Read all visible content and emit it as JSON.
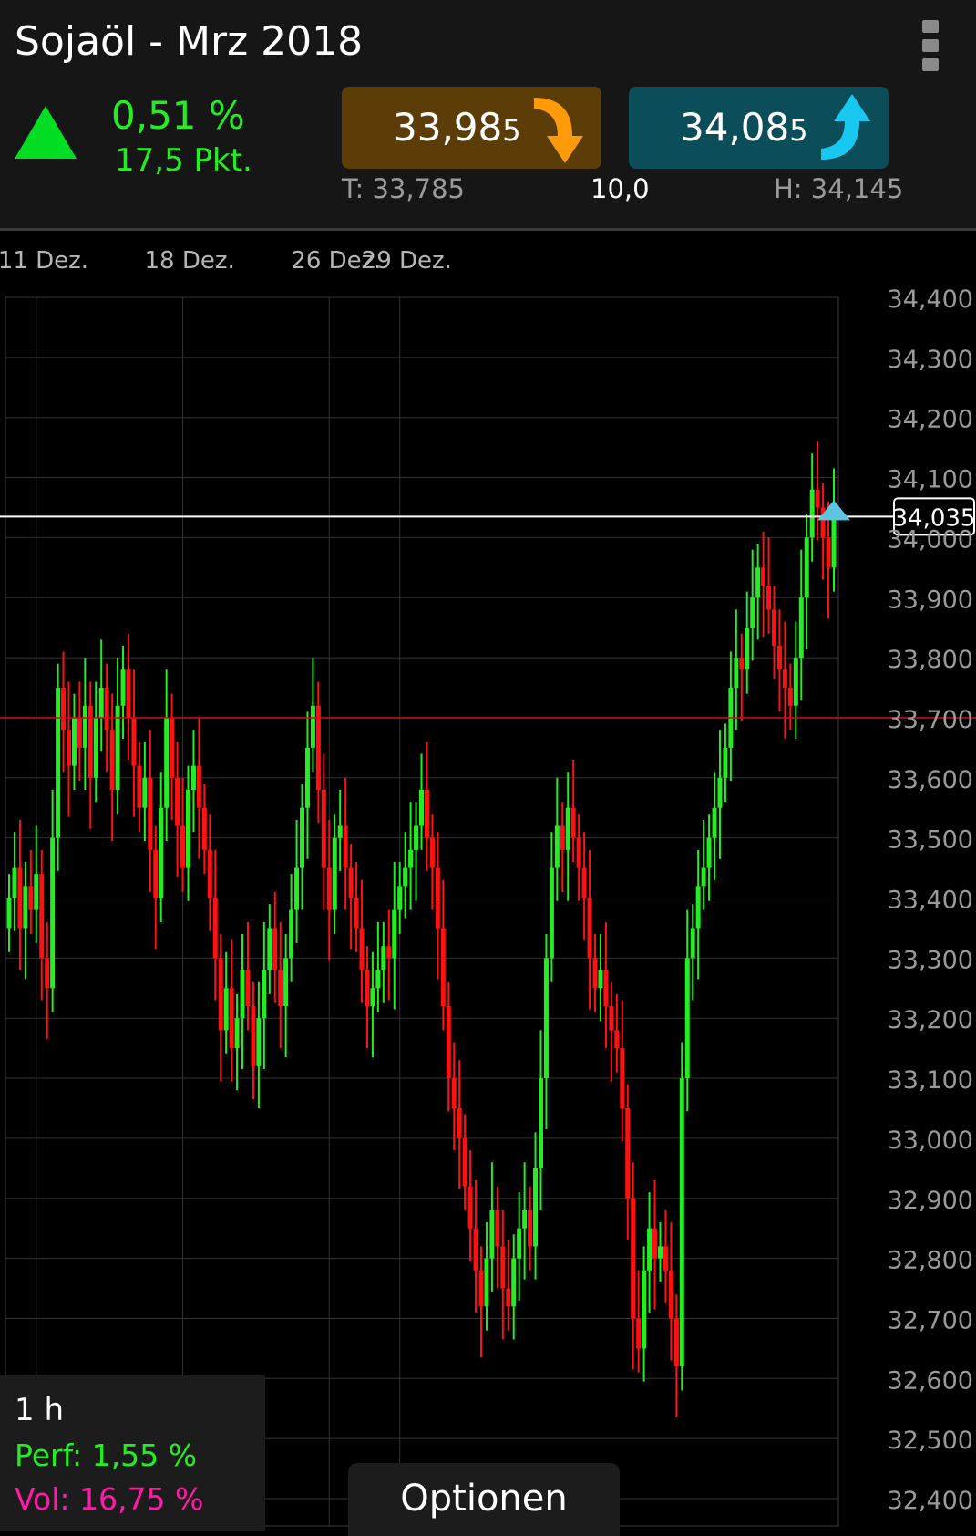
{
  "header": {
    "title": "Sojaöl - Mrz 2018",
    "change_percent": "0,51 %",
    "change_points": "17,5 Pkt.",
    "trend": "up",
    "bid": {
      "main": "33,98",
      "suffix": "5",
      "arrow": "arrow-down-icon"
    },
    "ask": {
      "main": "34,08",
      "suffix": "5",
      "arrow": "arrow-up-icon"
    },
    "low": "T: 33,785",
    "high": "H: 34,145",
    "spread": "10,0",
    "menu_icon": "overflow-menu-icon"
  },
  "colors": {
    "up": "#22ee22",
    "down": "#ff1111",
    "bid_bg": "#5c3d08",
    "ask_bg": "#0b4d58",
    "vol": "#ff1aa8"
  },
  "chart_data": {
    "type": "candlestick",
    "interval": "1 h",
    "x_labels": [
      "11 Dez.",
      "18 Dez.",
      "26 Dez.",
      "29 Dez."
    ],
    "y_ticks": [
      "34,400",
      "34,300",
      "34,200",
      "34,100",
      "34,000",
      "33,900",
      "33,800",
      "33,700",
      "33,600",
      "33,500",
      "33,400",
      "33,300",
      "33,200",
      "33,100",
      "33,000",
      "32,900",
      "32,800",
      "32,700",
      "32,600",
      "32,500",
      "32,400"
    ],
    "ylim": [
      32.4,
      34.4
    ],
    "current_price": 34.035,
    "current_price_label": "34,035",
    "reference_price": 33.7,
    "grid": true,
    "series": [
      [
        33.4,
        33.45,
        33.35,
        33.42,
        33.38,
        33.44,
        33.3,
        33.25,
        33.5,
        33.75,
        33.68,
        33.62,
        33.7,
        33.65,
        33.72,
        33.6,
        33.7,
        33.75,
        33.68,
        33.58,
        33.72,
        33.78,
        33.7,
        33.62,
        33.55,
        33.6,
        33.48,
        33.4,
        33.55,
        33.7,
        33.6,
        33.52,
        33.45,
        33.58,
        33.62,
        33.55,
        33.48,
        33.4,
        33.3,
        33.18,
        33.25,
        33.15,
        33.2,
        33.28,
        33.22,
        33.12,
        33.2,
        33.28,
        33.35,
        33.28,
        33.22,
        33.3,
        33.38,
        33.45,
        33.55,
        33.65,
        33.72,
        33.58,
        33.45,
        33.38,
        33.5,
        33.52,
        33.45,
        33.4,
        33.35,
        33.28,
        33.22,
        33.25,
        33.28,
        33.32,
        33.3,
        33.38,
        33.42,
        33.45,
        33.48,
        33.52,
        33.58,
        33.5,
        33.45,
        33.35,
        33.22,
        33.1,
        33.05,
        33.0,
        32.92,
        32.85,
        32.78,
        32.72,
        32.8,
        32.88,
        32.82,
        32.75,
        32.72,
        32.8,
        32.85,
        32.88,
        32.82,
        32.95,
        33.1,
        33.3,
        33.45,
        33.52,
        33.48,
        33.55,
        33.5,
        33.45,
        33.4,
        33.3,
        33.25,
        33.28,
        33.22,
        33.18,
        33.15,
        33.05,
        32.9,
        32.7,
        32.65,
        32.78,
        32.85,
        32.8,
        32.82,
        32.78,
        32.7,
        32.62,
        33.1,
        33.3,
        33.35,
        33.42,
        33.45,
        33.5,
        33.55,
        33.6,
        33.65,
        33.75,
        33.8,
        33.78,
        33.85,
        33.9,
        33.95,
        33.92,
        33.88,
        33.82,
        33.78,
        33.75,
        33.72,
        33.8,
        33.9,
        34.0,
        34.08,
        34.05,
        34.0,
        33.95,
        34.035
      ]
    ]
  },
  "panel": {
    "interval": "1 h",
    "perf": "Perf: 1,55 %",
    "vol": "Vol: 16,75 %"
  },
  "options_label": "Optionen"
}
